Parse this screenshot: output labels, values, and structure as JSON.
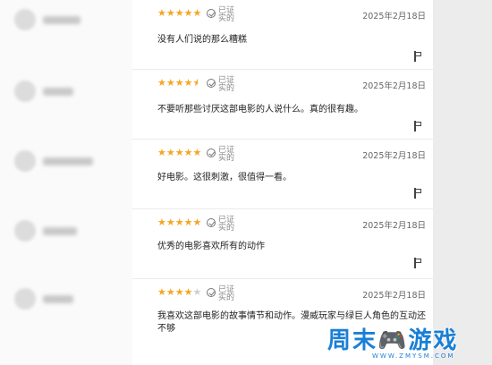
{
  "reviews": [
    {
      "stars": "★★★★★",
      "rating": 5,
      "verified": [
        "已证",
        "实的"
      ],
      "date": "2025年2月18日",
      "text": "没有人们说的那么糟糕"
    },
    {
      "stars": "★★★★",
      "half_star": "★",
      "rating": 4.5,
      "verified": [
        "已证",
        "实的"
      ],
      "date": "2025年2月18日",
      "text": "不要听那些讨厌这部电影的人说什么。真的很有趣。"
    },
    {
      "stars": "★★★★★",
      "rating": 5,
      "verified": [
        "已证",
        "实的"
      ],
      "date": "2025年2月18日",
      "text": "好电影。这很刺激，很值得一看。"
    },
    {
      "stars": "★★★★★",
      "rating": 5,
      "verified": [
        "已证",
        "实的"
      ],
      "date": "2025年2月18日",
      "text": "优秀的电影喜欢所有的动作"
    },
    {
      "stars": "★★★★",
      "empty_star": "★",
      "rating": 4,
      "verified": [
        "已证",
        "实的"
      ],
      "date": "2025年2月18日",
      "text": "我喜欢这部电影的故事情节和动作。漫威玩家与绿巨人角色的互动还不够"
    }
  ],
  "colors": {
    "star": "#f5a623",
    "star_empty": "#cfcfcf",
    "watermark": "#1a7fd6"
  },
  "icons": [
    "verified-check-icon",
    "flag-icon",
    "star-icon"
  ],
  "watermark": {
    "text": "周末🎮游戏",
    "url": "WWW.ZMYSM.COM"
  }
}
